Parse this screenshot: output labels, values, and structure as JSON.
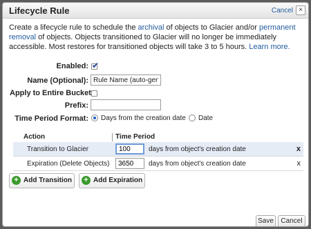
{
  "dialog": {
    "title": "Lifecycle Rule",
    "cancel_link": "Cancel",
    "close_glyph": "×"
  },
  "description": {
    "part1": "Create a lifecycle rule to schedule the ",
    "link_archival": "archival",
    "part2": " of objects to Glacier and/or ",
    "link_permanent_removal": "permanent removal",
    "part3": " of objects. Objects transitioned to Glacier will no longer be immediately accessible. Most restores for transitioned objects will take 3 to 5 hours. ",
    "link_learn_more": "Learn more."
  },
  "form": {
    "enabled_label": "Enabled:",
    "enabled_checked": true,
    "name_label": "Name (Optional):",
    "name_value": "Rule Name (auto-gener",
    "apply_label": "Apply to Entire Bucket:",
    "apply_checked": false,
    "prefix_label": "Prefix:",
    "prefix_value": "",
    "time_period_label": "Time Period Format:",
    "option_days": "Days from the creation date",
    "option_date": "Date",
    "selected_option": "days"
  },
  "table": {
    "col_action": "Action",
    "col_time_period": "Time Period",
    "rows": [
      {
        "action": "Transition to Glacier",
        "value": "100",
        "suffix": "days from object's creation date",
        "remove": "x"
      },
      {
        "action": "Expiration (Delete Objects)",
        "value": "3650",
        "suffix": "days from object's creation date",
        "remove": "x"
      }
    ]
  },
  "buttons": {
    "add_transition": "Add Transition",
    "add_expiration": "Add Expiration",
    "save": "Save",
    "cancel": "Cancel"
  },
  "icons": {
    "add_icon_glyph": "+",
    "check_glyph": "✔"
  }
}
